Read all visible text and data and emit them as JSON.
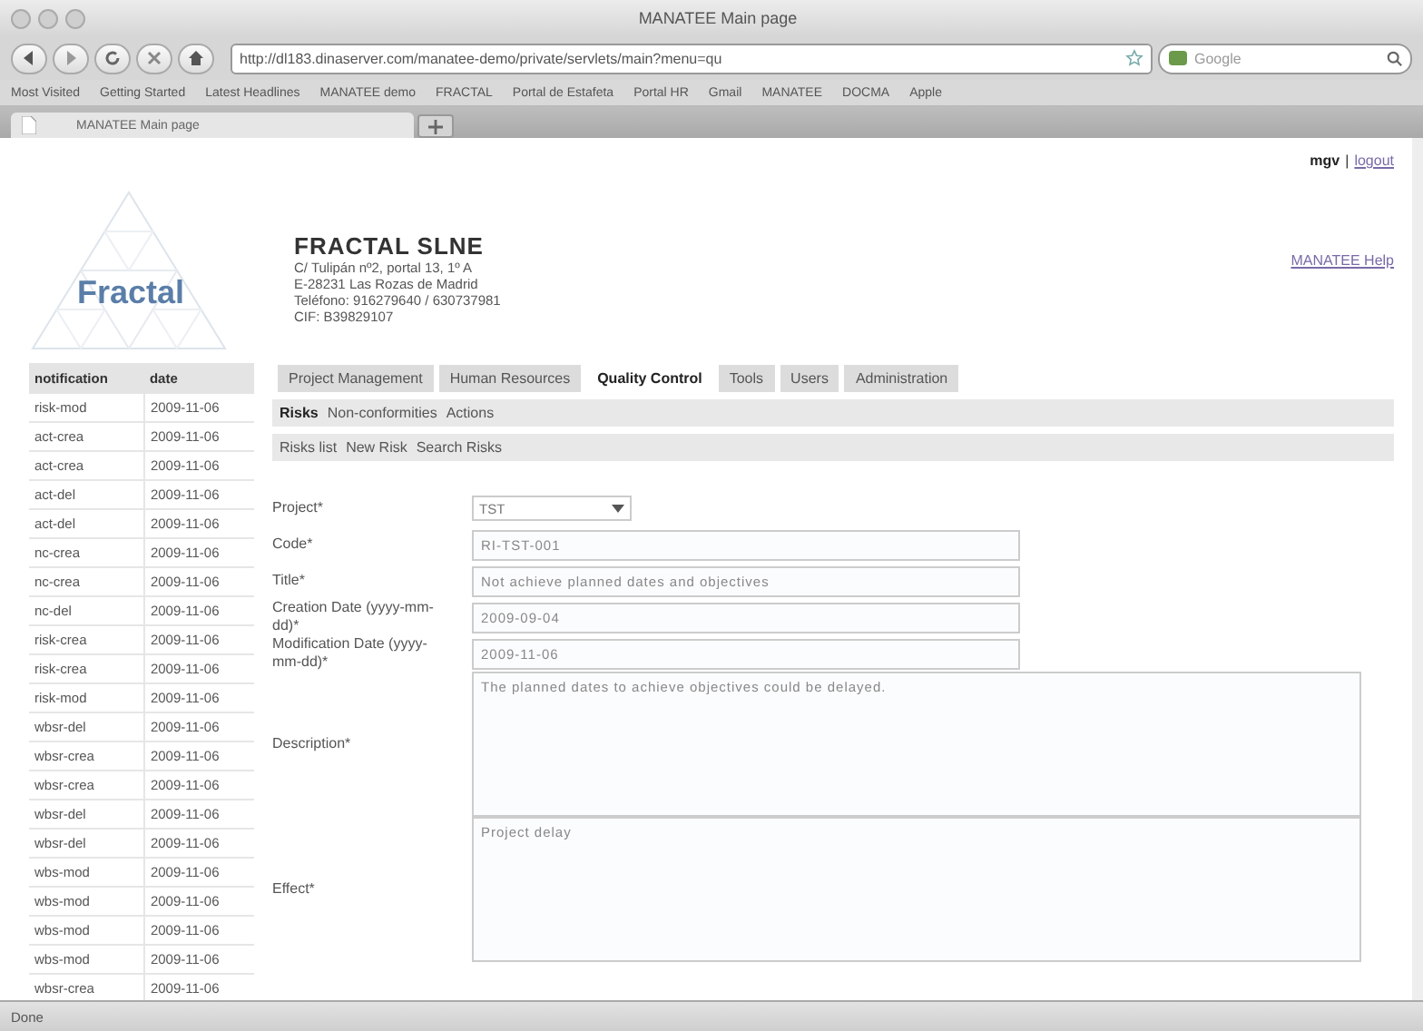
{
  "window": {
    "title": "MANATEE Main page"
  },
  "toolbar": {
    "url": "http://dl183.dinaserver.com/manatee-demo/private/servlets/main?menu=qu",
    "search_placeholder": "Google"
  },
  "bookmarks": [
    "Most Visited",
    "Getting Started",
    "Latest Headlines",
    "MANATEE demo",
    "FRACTAL",
    "Portal de Estafeta",
    "Portal HR",
    "Gmail",
    "MANATEE",
    "DOCMA",
    "Apple"
  ],
  "browser_tabs": [
    {
      "label": "MANATEE Main page",
      "selected": true
    }
  ],
  "company": {
    "logo_text": "Fractal",
    "name": "FRACTAL SLNE",
    "address": [
      "C/ Tulipán nº2, portal 13, 1º A",
      "E-28231 Las Rozas de Madrid",
      "Teléfono: 916279640 / 630737981",
      "CIF: B39829107"
    ]
  },
  "user": {
    "name": "mgv",
    "separator": "|",
    "logout": "logout"
  },
  "help_link": "MANATEE Help",
  "notifications": {
    "columns": [
      "notification",
      "date"
    ],
    "rows": [
      [
        "risk-mod",
        "2009-11-06"
      ],
      [
        "act-crea",
        "2009-11-06"
      ],
      [
        "act-crea",
        "2009-11-06"
      ],
      [
        "act-del",
        "2009-11-06"
      ],
      [
        "act-del",
        "2009-11-06"
      ],
      [
        "nc-crea",
        "2009-11-06"
      ],
      [
        "nc-crea",
        "2009-11-06"
      ],
      [
        "nc-del",
        "2009-11-06"
      ],
      [
        "risk-crea",
        "2009-11-06"
      ],
      [
        "risk-crea",
        "2009-11-06"
      ],
      [
        "risk-mod",
        "2009-11-06"
      ],
      [
        "wbsr-del",
        "2009-11-06"
      ],
      [
        "wbsr-crea",
        "2009-11-06"
      ],
      [
        "wbsr-crea",
        "2009-11-06"
      ],
      [
        "wbsr-del",
        "2009-11-06"
      ],
      [
        "wbsr-del",
        "2009-11-06"
      ],
      [
        "wbs-mod",
        "2009-11-06"
      ],
      [
        "wbs-mod",
        "2009-11-06"
      ],
      [
        "wbs-mod",
        "2009-11-06"
      ],
      [
        "wbs-mod",
        "2009-11-06"
      ],
      [
        "wbsr-crea",
        "2009-11-06"
      ]
    ]
  },
  "tabs": [
    {
      "label": "Project Management",
      "selected": false
    },
    {
      "label": "Human Resources",
      "selected": false
    },
    {
      "label": "Quality Control",
      "selected": true
    },
    {
      "label": "Tools",
      "selected": false
    },
    {
      "label": "Users",
      "selected": false
    },
    {
      "label": "Administration",
      "selected": false
    }
  ],
  "subtabs": [
    {
      "label": "Risks",
      "selected": true
    },
    {
      "label": "Non-conformities",
      "selected": false
    },
    {
      "label": "Actions",
      "selected": false
    }
  ],
  "actions": [
    "Risks list",
    "New Risk",
    "Search Risks"
  ],
  "form": [
    {
      "kind": "select",
      "label": "Project*",
      "value": "TST"
    },
    {
      "kind": "text",
      "label": "Code*",
      "value": "RI-TST-001"
    },
    {
      "kind": "text",
      "label": "Title*",
      "value": "Not achieve planned dates and objectives"
    },
    {
      "kind": "text",
      "label": "Creation Date (yyyy-mm-dd)*",
      "value": "2009-09-04"
    },
    {
      "kind": "text",
      "label": "Modification Date (yyyy-mm-dd)*",
      "value": "2009-11-06"
    },
    {
      "kind": "area",
      "label": "Description*",
      "value": "The planned dates to achieve objectives could be delayed."
    },
    {
      "kind": "area",
      "label": "Effect*",
      "value": "Project delay"
    }
  ],
  "status_bar": {
    "text": "Done"
  }
}
